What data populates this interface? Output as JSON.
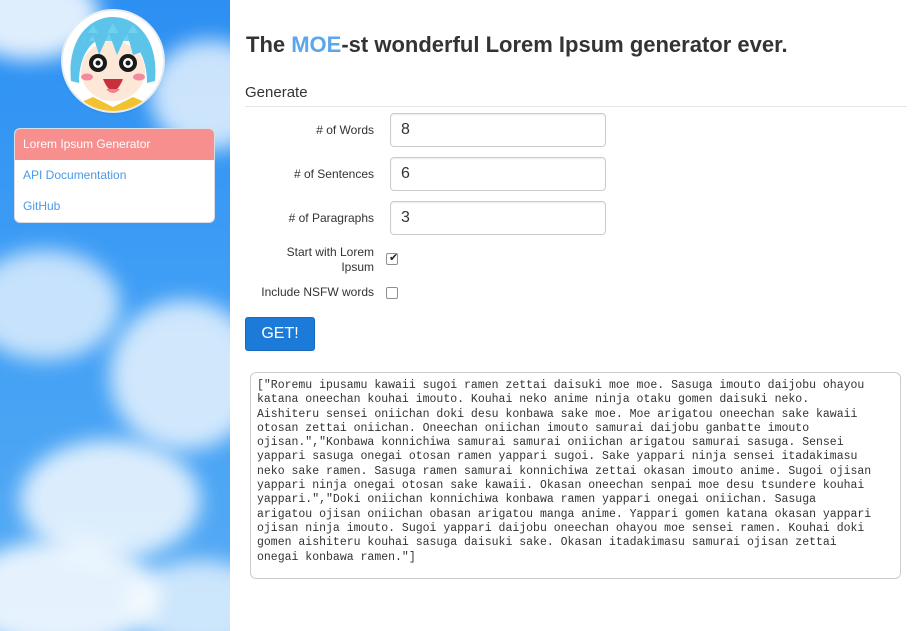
{
  "header": {
    "title_prefix": "The ",
    "title_accent": "MOE",
    "title_suffix": "-st wonderful Lorem Ipsum generator ever."
  },
  "sidebar": {
    "items": [
      {
        "label": "Lorem Ipsum Generator",
        "active": true
      },
      {
        "label": "API Documentation",
        "active": false
      },
      {
        "label": "GitHub",
        "active": false
      }
    ]
  },
  "form": {
    "section_title": "Generate",
    "words": {
      "label": "# of Words",
      "value": "8"
    },
    "sentences": {
      "label": "# of Sentences",
      "value": "6"
    },
    "paragraphs": {
      "label": "# of Paragraphs",
      "value": "3"
    },
    "start_lorem": {
      "label_line1": "Start with Lorem",
      "label_line2": "Ipsum",
      "checked": true
    },
    "nsfw": {
      "label": "Include NSFW words",
      "checked": false
    },
    "submit_label": "GET!"
  },
  "output": {
    "text": "[\"Roremu ipusamu kawaii sugoi ramen zettai daisuki moe moe. Sasuga imouto daijobu ohayou\nkatana oneechan kouhai imouto. Kouhai neko anime ninja otaku gomen daisuki neko.\nAishiteru sensei oniichan doki desu konbawa sake moe. Moe arigatou oneechan sake kawaii\notosan zettai oniichan. Oneechan oniichan imouto samurai daijobu ganbatte imouto\nojisan.\",\"Konbawa konnichiwa samurai samurai oniichan arigatou samurai sasuga. Sensei\nyappari sasuga onegai otosan ramen yappari sugoi. Sake yappari ninja sensei itadakimasu\nneko sake ramen. Sasuga ramen samurai konnichiwa zettai okasan imouto anime. Sugoi ojisan\nyappari ninja onegai otosan sake kawaii. Okasan oneechan senpai moe desu tsundere kouhai\nyappari.\",\"Doki oniichan konnichiwa konbawa ramen yappari onegai oniichan. Sasuga\narigatou ojisan oniichan obasan arigatou manga anime. Yappari gomen katana okasan yappari\nojisan ninja imouto. Sugoi yappari daijobu oneechan ohayou moe sensei ramen. Kouhai doki\ngomen aishiteru kouhai sasuga daisuki sake. Okasan itadakimasu samurai ojisan zettai\nonegai konbawa ramen.\"]"
  },
  "colors": {
    "accent": "#5ba6ec",
    "active_nav": "#f78f8f",
    "button": "#1c7bd8",
    "link": "#4a9ae8",
    "sky": "#3f9ef5"
  },
  "icons": {
    "avatar": "anime-girl-avatar",
    "checkmark": "checkmark-icon"
  }
}
